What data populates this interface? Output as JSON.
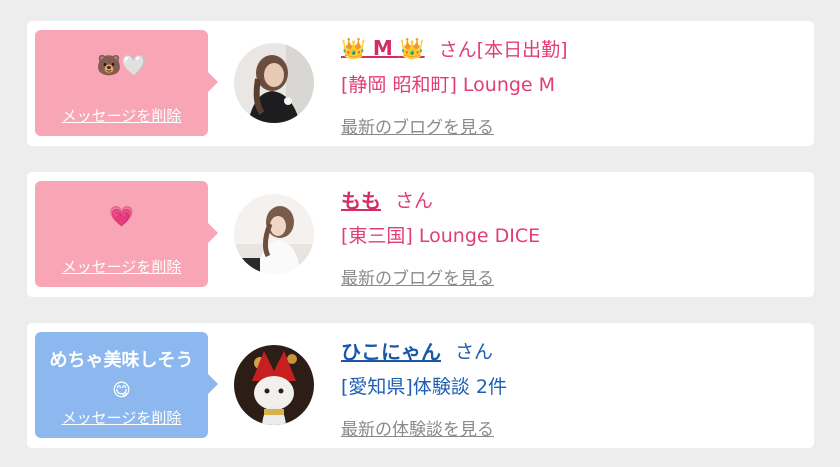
{
  "items": [
    {
      "bubble_text": "🐻🤍",
      "delete_label": "メッセージを削除",
      "name_prefix": "👑",
      "name": " M ",
      "name_suffix": "👑",
      "san": "さん",
      "tag": "[本日出勤]",
      "shop": "[静岡 昭和町] Lounge M",
      "link": "最新のブログを見る",
      "bubble_color": "#f8a5b5",
      "text_color": "#e23e74"
    },
    {
      "bubble_text": "💗",
      "delete_label": "メッセージを削除",
      "name": "もも",
      "san": "さん",
      "shop": "[東三国] Lounge DICE",
      "link": "最新のブログを見る",
      "bubble_color": "#f8a5b5",
      "text_color": "#e23e74"
    },
    {
      "bubble_text": "めちゃ美味しそう",
      "bubble_emoji": "😋",
      "delete_label": "メッセージを削除",
      "name": "ひこにゃん",
      "san": "さん",
      "shop": "[愛知県]体験談 2件",
      "link": "最新の体験談を見る",
      "bubble_color": "#8cb8ef",
      "text_color": "#1f5fb3"
    }
  ]
}
